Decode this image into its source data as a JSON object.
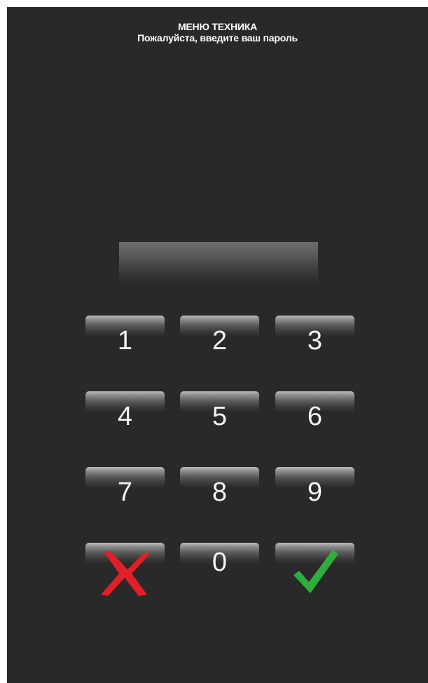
{
  "header": {
    "title": "МЕНЮ ТЕХНИКА",
    "subtitle": "Пожалуйста, введите ваш пароль"
  },
  "password_field": {
    "value": ""
  },
  "keypad": {
    "keys": [
      {
        "label": "1"
      },
      {
        "label": "2"
      },
      {
        "label": "3"
      },
      {
        "label": "4"
      },
      {
        "label": "5"
      },
      {
        "label": "6"
      },
      {
        "label": "7"
      },
      {
        "label": "8"
      },
      {
        "label": "9"
      },
      {
        "icon": "cancel-x-icon",
        "color": "#e01f26"
      },
      {
        "label": "0"
      },
      {
        "icon": "confirm-check-icon",
        "color": "#2fae3d"
      }
    ]
  },
  "colors": {
    "background": "#2a292a",
    "text": "#ffffff",
    "cancel": "#e01f26",
    "confirm": "#2fae3d"
  }
}
